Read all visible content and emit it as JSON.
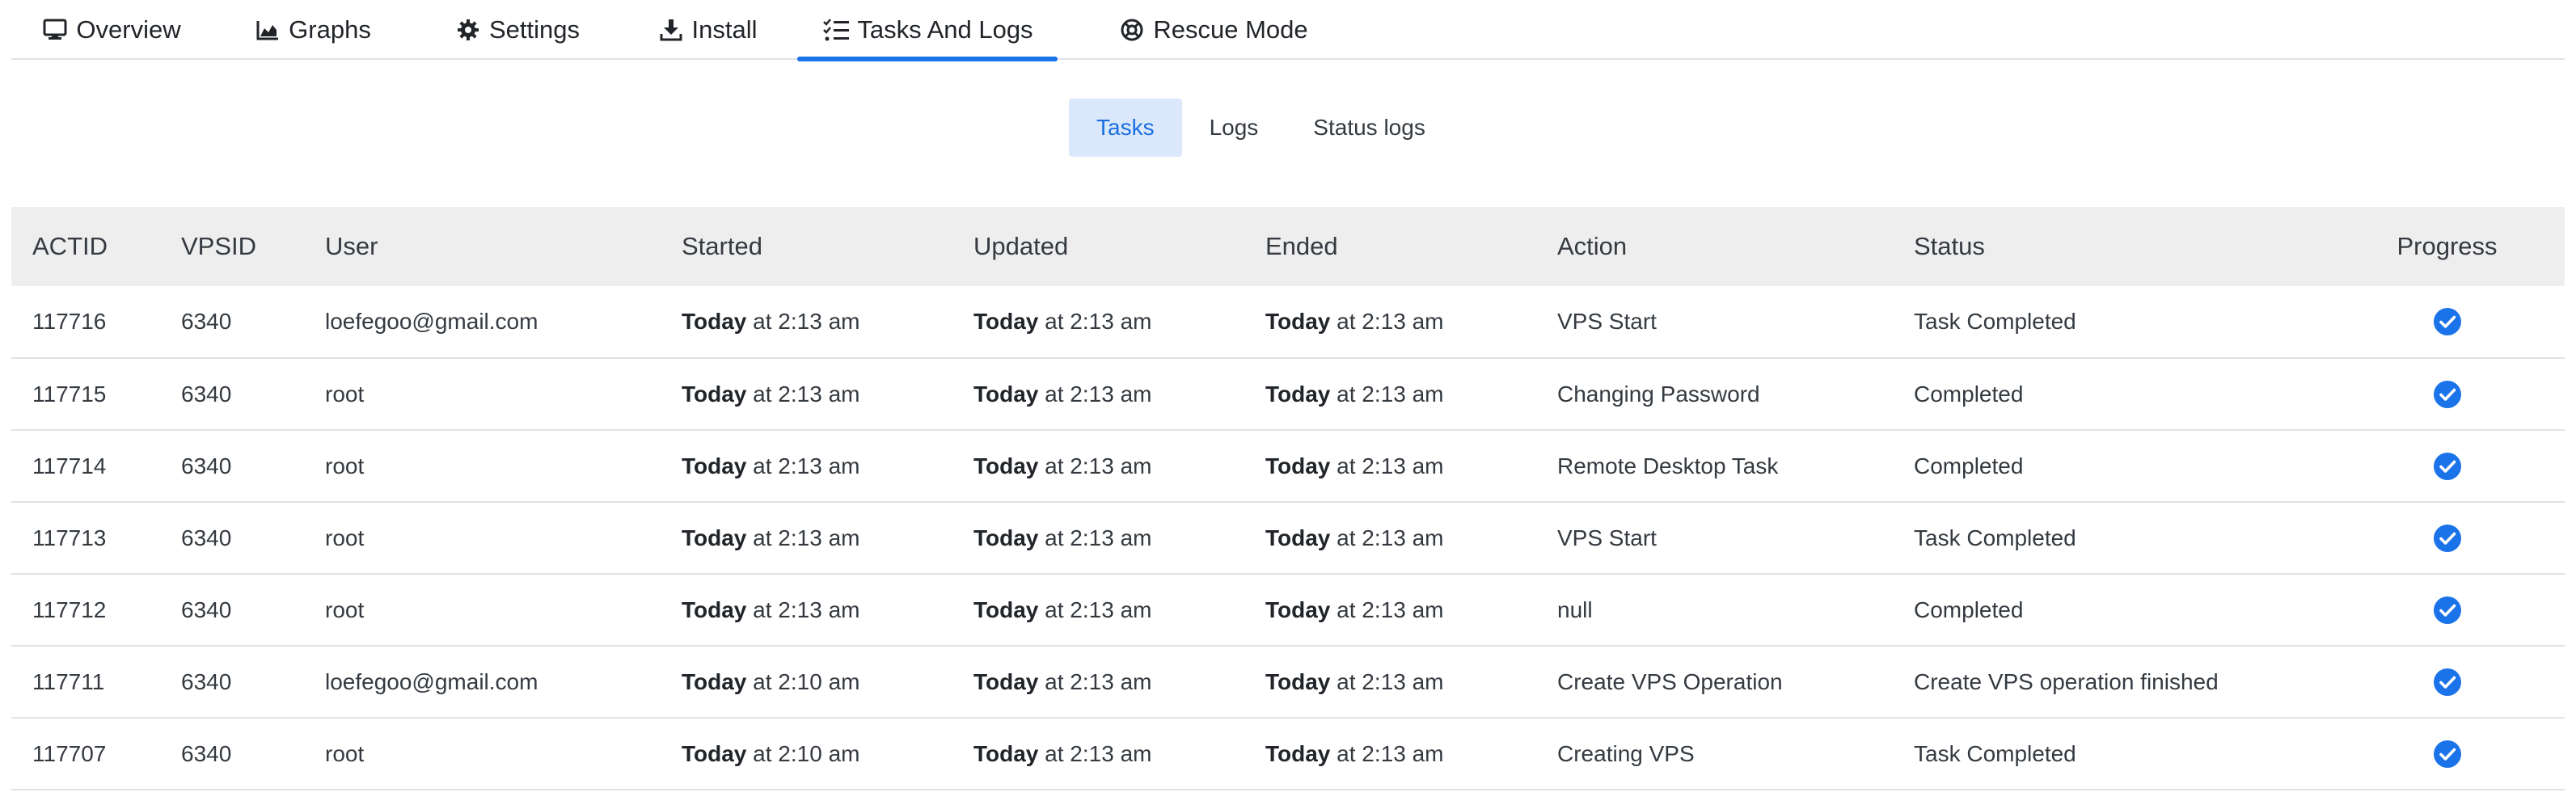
{
  "nav": {
    "tabs": [
      {
        "label": "Overview",
        "icon": "monitor-icon",
        "active": false
      },
      {
        "label": "Graphs",
        "icon": "area-chart-icon",
        "active": false
      },
      {
        "label": "Settings",
        "icon": "gear-icon",
        "active": false
      },
      {
        "label": "Install",
        "icon": "download-icon",
        "active": false
      },
      {
        "label": "Tasks And Logs",
        "icon": "checklist-icon",
        "active": true
      },
      {
        "label": "Rescue Mode",
        "icon": "lifebuoy-icon",
        "active": false
      }
    ]
  },
  "subtabs": {
    "items": [
      {
        "label": "Tasks",
        "active": true
      },
      {
        "label": "Logs",
        "active": false
      },
      {
        "label": "Status logs",
        "active": false
      }
    ]
  },
  "table": {
    "headers": [
      "ACTID",
      "VPSID",
      "User",
      "Started",
      "Updated",
      "Ended",
      "Action",
      "Status",
      "Progress"
    ],
    "rows": [
      {
        "actid": "117716",
        "vpsid": "6340",
        "user": "loefegoo@gmail.com",
        "started_day": "Today",
        "started_time": " at 2:13 am",
        "updated_day": "Today",
        "updated_time": " at 2:13 am",
        "ended_day": "Today",
        "ended_time": " at 2:13 am",
        "action": "VPS Start",
        "status": "Task Completed",
        "progress": "check-circle-icon"
      },
      {
        "actid": "117715",
        "vpsid": "6340",
        "user": "root",
        "started_day": "Today",
        "started_time": " at 2:13 am",
        "updated_day": "Today",
        "updated_time": " at 2:13 am",
        "ended_day": "Today",
        "ended_time": " at 2:13 am",
        "action": "Changing Password",
        "status": "Completed",
        "progress": "check-circle-icon"
      },
      {
        "actid": "117714",
        "vpsid": "6340",
        "user": "root",
        "started_day": "Today",
        "started_time": " at 2:13 am",
        "updated_day": "Today",
        "updated_time": " at 2:13 am",
        "ended_day": "Today",
        "ended_time": " at 2:13 am",
        "action": "Remote Desktop Task",
        "status": "Completed",
        "progress": "check-circle-icon"
      },
      {
        "actid": "117713",
        "vpsid": "6340",
        "user": "root",
        "started_day": "Today",
        "started_time": " at 2:13 am",
        "updated_day": "Today",
        "updated_time": " at 2:13 am",
        "ended_day": "Today",
        "ended_time": " at 2:13 am",
        "action": "VPS Start",
        "status": "Task Completed",
        "progress": "check-circle-icon"
      },
      {
        "actid": "117712",
        "vpsid": "6340",
        "user": "root",
        "started_day": "Today",
        "started_time": " at 2:13 am",
        "updated_day": "Today",
        "updated_time": " at 2:13 am",
        "ended_day": "Today",
        "ended_time": " at 2:13 am",
        "action": "null",
        "status": "Completed",
        "progress": "check-circle-icon"
      },
      {
        "actid": "117711",
        "vpsid": "6340",
        "user": "loefegoo@gmail.com",
        "started_day": "Today",
        "started_time": " at 2:10 am",
        "updated_day": "Today",
        "updated_time": " at 2:13 am",
        "ended_day": "Today",
        "ended_time": " at 2:13 am",
        "action": "Create VPS Operation",
        "status": "Create VPS operation finished",
        "progress": "check-circle-icon"
      },
      {
        "actid": "117707",
        "vpsid": "6340",
        "user": "root",
        "started_day": "Today",
        "started_time": " at 2:10 am",
        "updated_day": "Today",
        "updated_time": " at 2:13 am",
        "ended_day": "Today",
        "ended_time": " at 2:13 am",
        "action": "Creating VPS",
        "status": "Task Completed",
        "progress": "check-circle-icon"
      }
    ]
  },
  "colors": {
    "accent": "#1a73e8",
    "subtab_active_bg": "#dbe8fb",
    "header_bg": "#eeeeee"
  }
}
